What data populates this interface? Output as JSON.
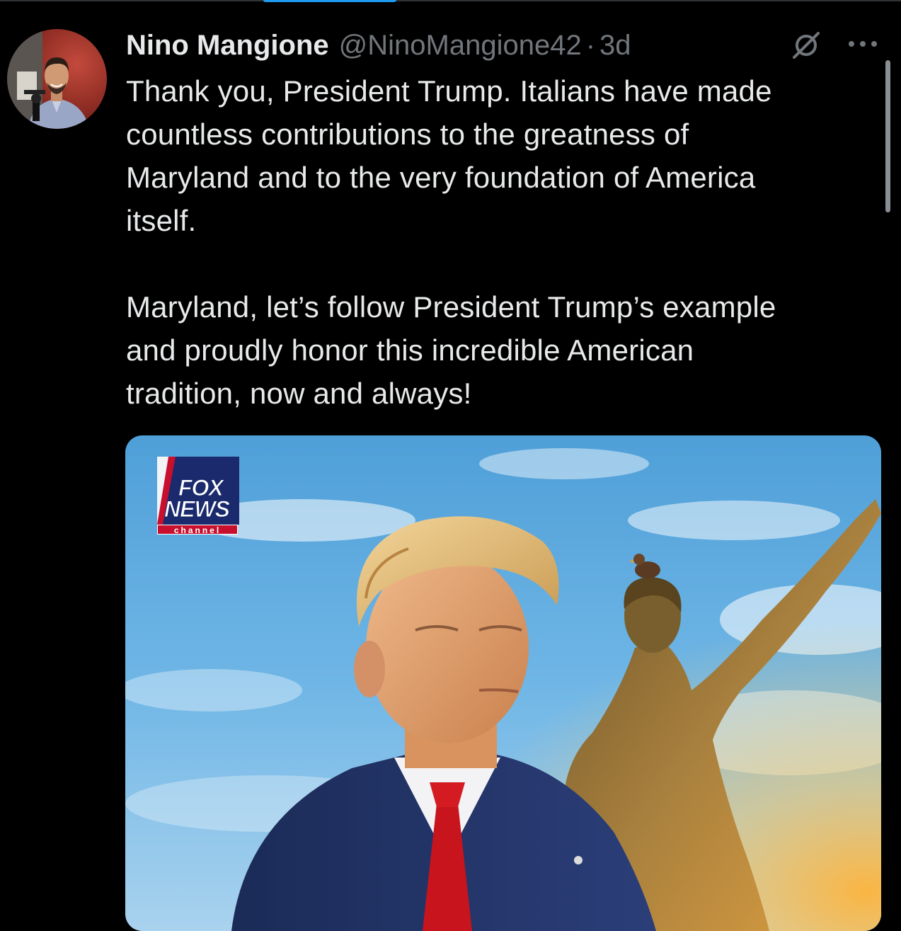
{
  "tweet": {
    "author": {
      "display_name": "Nino Mangione",
      "handle": "@NinoMangione42",
      "separator": "·",
      "time": "3d"
    },
    "icons": {
      "grok": "grok-icon",
      "more": "more-options-icon"
    },
    "text": "Thank you, President Trump. Italians have made\ncountless contributions to the greatness of\nMaryland and to the very foundation of America\nitself.\n\nMaryland, let’s follow President Trump’s example\nand proudly honor this incredible American\ntradition, now and always!",
    "media": {
      "logo_line1": "FOX",
      "logo_line2": "NEWS",
      "logo_channel": "channel"
    }
  },
  "colors": {
    "background": "#000000",
    "text_primary": "#e7e9ea",
    "text_secondary": "#71767b",
    "accent": "#1d9bf0"
  }
}
